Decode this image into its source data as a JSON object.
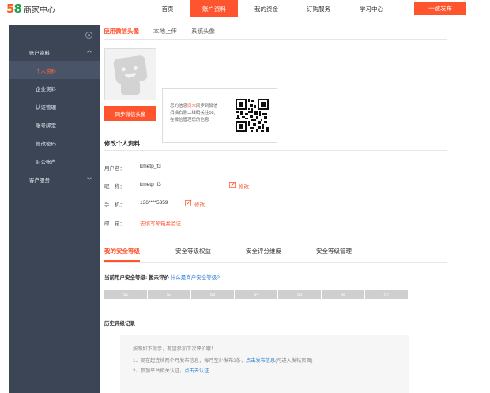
{
  "header": {
    "logo_number": "58",
    "logo_text": "商家中心",
    "nav": [
      "首页",
      "账户资料",
      "我的资金",
      "订购服务",
      "学习中心"
    ],
    "active_nav": "账户资料",
    "publish_button": "一键发布"
  },
  "sidebar": {
    "groups": [
      {
        "label": "账户资料",
        "expanded": true,
        "items": [
          "个人资料",
          "企业资料",
          "认证管理",
          "账号绑定",
          "修改密码",
          "对公账户"
        ]
      },
      {
        "label": "客户服务",
        "expanded": false,
        "items": []
      }
    ],
    "selected": "个人资料"
  },
  "avatar_tabs": [
    "使用微信头像",
    "本地上传",
    "系统头像"
  ],
  "avatar_tab_active": "使用微信头像",
  "sync_button": "同步微信头像",
  "wechat_tip": {
    "line1_pre": "您的信息",
    "line1_highlight": "尚未",
    "line1_post": "同步到微信",
    "line2": "扫描右侧二维码关注58,",
    "line3": "在微信管理您的信息"
  },
  "profile": {
    "title": "修改个人资料",
    "username_label": "用户名：",
    "username_value": "kmetp_f3",
    "nickname_label": "昵　称：",
    "nickname_value": "kmetp_f3",
    "nickname_edit": "修改",
    "phone_label": "手　机：",
    "phone_value": "136****5359",
    "phone_edit": "修改",
    "email_label": "邮　箱：",
    "email_link": "去填写邮箱并验证"
  },
  "security_tabs": [
    "我的安全等级",
    "安全等级权益",
    "安全评分维度",
    "安全等级管理"
  ],
  "security_tab_active": "我的安全等级",
  "security": {
    "current_level_text": "当前用户安全等级: 暂未评价",
    "what_link": "什么是商户安全等级?",
    "levels": [
      "S1",
      "S2",
      "S3",
      "S4",
      "S5",
      "S6",
      "S7"
    ]
  },
  "history": {
    "title": "历史评级记录",
    "hint": "按照如下提示，有望参加下次评价哦！",
    "tip1_pre": "1、现在起连续两个月发布信息，每月至少发布2条，",
    "tip1_link": "点击发布信息",
    "tip1_post": "(可进入发帖页面)",
    "tip2_pre": "2、参加平台相关认证，",
    "tip2_link": "点击去认证"
  },
  "colors": {
    "accent": "#ff552e",
    "sidebar_bg": "#3b4556",
    "link": "#2d7fd6"
  }
}
